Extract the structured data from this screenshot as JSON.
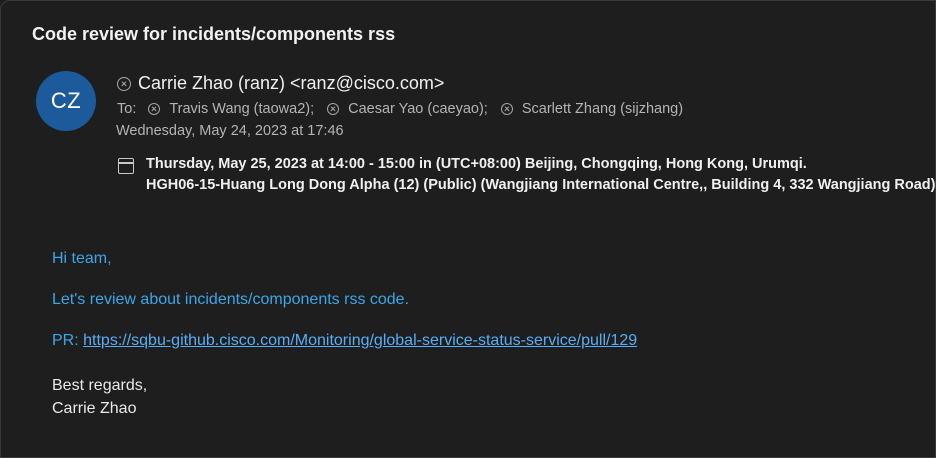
{
  "email": {
    "subject": "Code review for incidents/components rss",
    "avatar_initials": "CZ",
    "from": "Carrie Zhao (ranz) <ranz@cisco.com>",
    "to_label": "To:",
    "recipients": [
      "Travis Wang (taowa2);",
      "Caesar Yao (caeyao);",
      "Scarlett Zhang (sijzhang)"
    ],
    "sent_date": "Wednesday, May 24, 2023 at 17:46",
    "meeting": {
      "time": "Thursday, May 25, 2023 at 14:00 - 15:00 in (UTC+08:00) Beijing, Chongqing, Hong Kong, Urumqi.",
      "location": "HGH06-15-Huang Long Dong Alpha (12) (Public) (Wangjiang International Centre,, Building 4, 332 Wangjiang Road)"
    },
    "body": {
      "greeting": "Hi team,",
      "line1": "Let's review about incidents/components rss code.",
      "pr_label": "PR: ",
      "pr_link": "https://sqbu-github.cisco.com/Monitoring/global-service-status-service/pull/129",
      "closing": "Best regards,",
      "signature": "Carrie Zhao"
    }
  },
  "colors": {
    "background": "#1e1e1e",
    "avatar": "#1d5a9c",
    "body_blue": "#3aa7e8",
    "link": "#58aef6"
  }
}
